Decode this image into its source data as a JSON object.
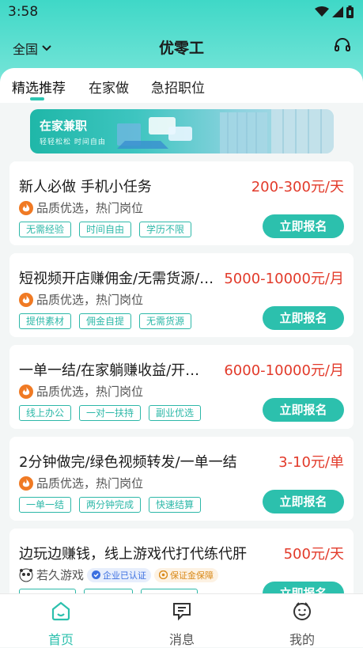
{
  "statusbar": {
    "time": "3:58"
  },
  "header": {
    "city": "全国",
    "title": "优零工"
  },
  "tabs": [
    {
      "label": "精选推荐"
    },
    {
      "label": "在家做"
    },
    {
      "label": "急招职位"
    }
  ],
  "banner": {
    "title": "在家兼职",
    "subtitle": "轻轻松松 时间自由"
  },
  "jobs": [
    {
      "title": "新人必做 手机小任务",
      "salary": "200-300元/天",
      "subtitle": "品质优选，热门岗位",
      "tags": [
        "无需经验",
        "时间自由",
        "学历不限"
      ],
      "apply": "立即报名"
    },
    {
      "title": "短视频开店赚佣金/无需货源/…",
      "salary": "5000-10000元/月",
      "subtitle": "品质优选，热门岗位",
      "tags": [
        "提供素材",
        "佣金自提",
        "无需货源"
      ],
      "apply": "立即报名"
    },
    {
      "title": "一单一结/在家躺赚收益/开…",
      "salary": "6000-10000元/月",
      "subtitle": "品质优选，热门岗位",
      "tags": [
        "线上办公",
        "一对一扶持",
        "副业优选"
      ],
      "apply": "立即报名"
    },
    {
      "title": "2分钟做完/绿色视频转发/一单一结",
      "salary": "3-10元/单",
      "subtitle": "品质优选，热门岗位",
      "tags": [
        "一单一结",
        "两分钟完成",
        "快速结算"
      ],
      "apply": "立即报名"
    },
    {
      "title": "边玩边赚钱，线上游戏代打代练代肝",
      "salary": "500元/天",
      "company": "若久游戏",
      "badge_verified": "企业已认证",
      "badge_deposit": "保证金保障",
      "apply": "立即报名"
    }
  ],
  "bottom_nav": [
    {
      "label": "首页"
    },
    {
      "label": "消息"
    },
    {
      "label": "我的"
    }
  ],
  "colors": {
    "accent": "#2cc0ad",
    "salary": "#e23a2a",
    "flame": "#f07a24"
  }
}
